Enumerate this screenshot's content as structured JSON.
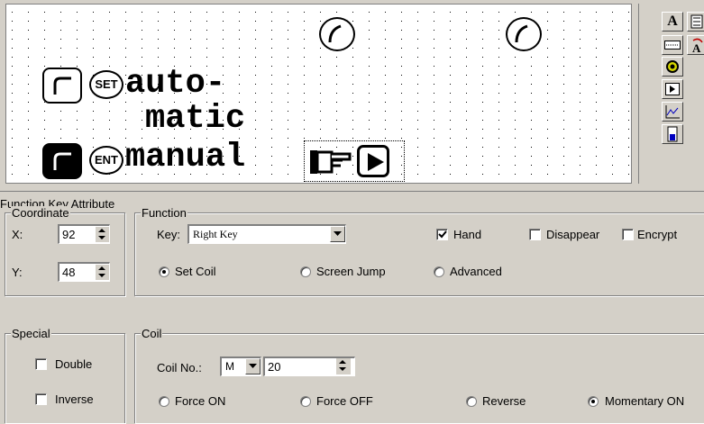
{
  "canvas": {
    "line1": "auto-",
    "line2": "matic",
    "line3": "manual",
    "set_badge": "SET",
    "ent_badge": "ENT"
  },
  "toolbar": {
    "icons": [
      "text-icon",
      "barcode-icon",
      "text-rotate-icon",
      "lamp-icon",
      "function-key-icon",
      "trend-graph-icon",
      "bar-meter-icon"
    ],
    "text_button": "A"
  },
  "panel": {
    "title": "Function Key Attribute",
    "coordinate": {
      "legend": "Coordinate",
      "x_label": "X:",
      "x_value": "92",
      "y_label": "Y:",
      "y_value": "48"
    },
    "function": {
      "legend": "Function",
      "key_label": "Key:",
      "key_value": "Right Key",
      "hand_label": "Hand",
      "hand_checked": true,
      "disappear_label": "Disappear",
      "encrypt_label": "Encrypt",
      "options": [
        "Set Coil",
        "Screen Jump",
        "Advanced"
      ],
      "selected": "Set Coil"
    },
    "special": {
      "legend": "Special",
      "double_label": "Double",
      "inverse_label": "Inverse"
    },
    "coil": {
      "legend": "Coil",
      "coil_no_label": "Coil No.:",
      "device": "M",
      "number": "20",
      "modes": [
        "Force ON",
        "Force OFF",
        "Reverse",
        "Momentary ON"
      ],
      "selected": "Momentary ON"
    }
  }
}
